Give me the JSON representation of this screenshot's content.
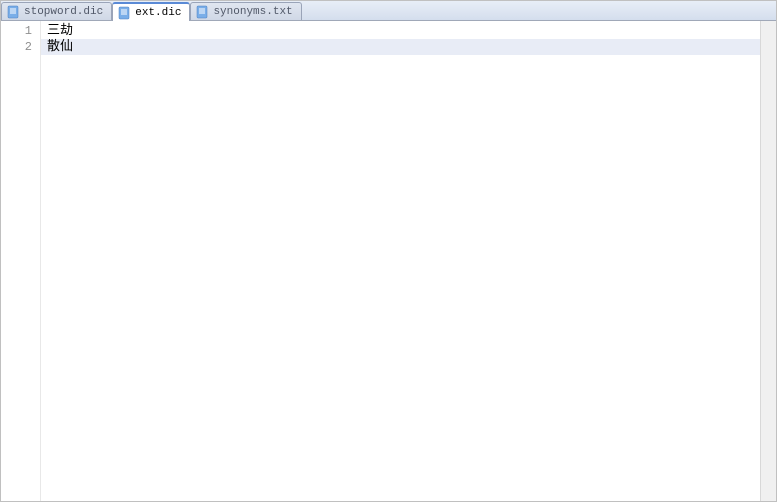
{
  "tabs": [
    {
      "label": "stopword.dic",
      "active": false
    },
    {
      "label": "ext.dic",
      "active": true
    },
    {
      "label": "synonyms.txt",
      "active": false
    }
  ],
  "lines": [
    {
      "num": "1",
      "text": "三劫"
    },
    {
      "num": "2",
      "text": "散仙"
    }
  ],
  "currentLine": 2
}
